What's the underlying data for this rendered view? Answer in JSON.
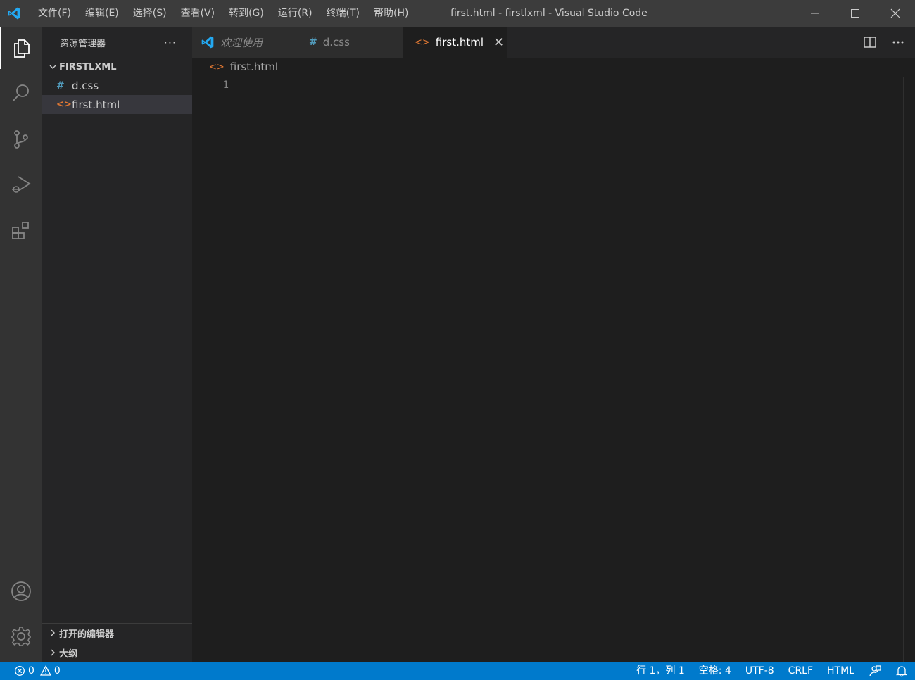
{
  "menu": [
    "文件(F)",
    "编辑(E)",
    "选择(S)",
    "查看(V)",
    "转到(G)",
    "运行(R)",
    "终端(T)",
    "帮助(H)"
  ],
  "window_title": "first.html - firstlxml - Visual Studio Code",
  "sidebar": {
    "title": "资源管理器",
    "more": "···",
    "folder": "FIRSTLXML",
    "files": [
      {
        "name": "d.css",
        "icon": "#"
      },
      {
        "name": "first.html",
        "icon": "<>"
      }
    ],
    "open_editors": "打开的编辑器",
    "outline": "大纲"
  },
  "tabs": [
    {
      "label": "欢迎使用"
    },
    {
      "label": "d.css",
      "icon": "#"
    },
    {
      "label": "first.html",
      "icon": "<>",
      "close": "✕"
    }
  ],
  "editor": {
    "breadcrumb": "first.html",
    "line_numbers": [
      "1"
    ]
  },
  "status": {
    "errors": "0",
    "warnings": "0",
    "position": "行 1，列 1",
    "spaces": "空格: 4",
    "encoding": "UTF-8",
    "eol": "CRLF",
    "language": "HTML"
  },
  "colors": {
    "accent": "#007acc",
    "css_icon": "#519aba",
    "html_icon": "#e37933"
  }
}
